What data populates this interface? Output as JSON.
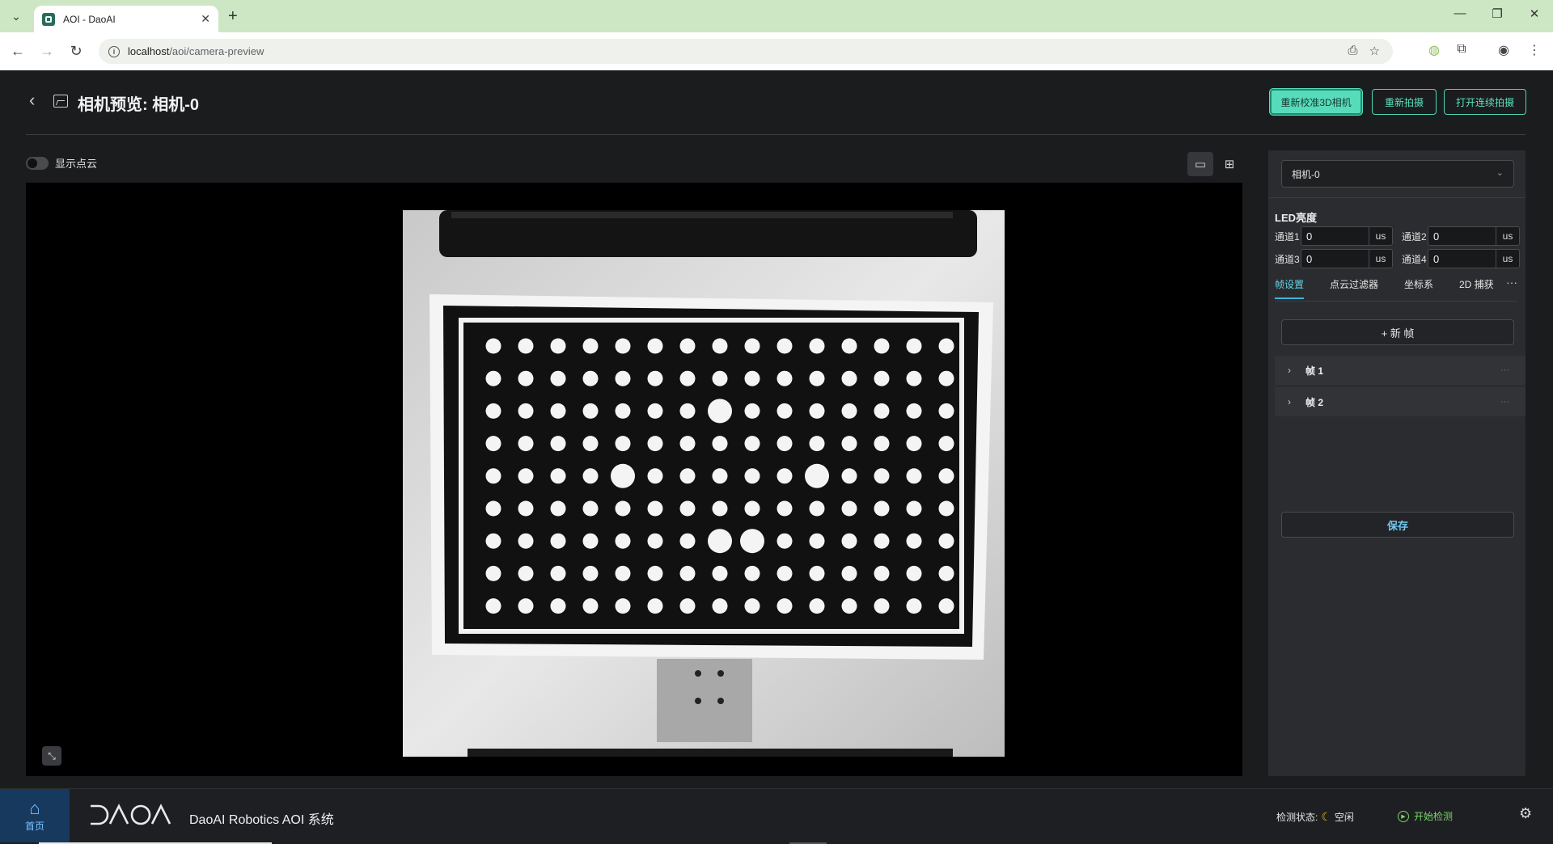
{
  "browser": {
    "tab_title": "AOI - DaoAI",
    "url_host": "localhost",
    "url_path": "/aoi/camera-preview"
  },
  "header": {
    "title": "相机预览: 相机-0",
    "recalibrate_label": "重新校准3D相机",
    "recapture_label": "重新拍摄",
    "continuous_label": "打开连续拍摄"
  },
  "viewer": {
    "point_cloud_toggle_label": "显示点云",
    "point_cloud_enabled": false,
    "dot_grid": {
      "rows": 9,
      "cols": 15
    }
  },
  "side": {
    "camera_select_value": "相机-0",
    "led_title": "LED亮度",
    "channels": [
      {
        "label": "通道1",
        "value": "0",
        "unit": "us"
      },
      {
        "label": "通道2",
        "value": "0",
        "unit": "us"
      },
      {
        "label": "通道3",
        "value": "0",
        "unit": "us"
      },
      {
        "label": "通道4",
        "value": "0",
        "unit": "us"
      }
    ],
    "tabs": [
      "帧设置",
      "点云过滤器",
      "坐标系",
      "2D 捕获"
    ],
    "active_tab": "帧设置",
    "add_frame_label": "+ 新 帧",
    "frames": [
      {
        "name": "帧 1",
        "more": "···"
      },
      {
        "name": "帧 2",
        "more": "···"
      }
    ],
    "save_label": "保存"
  },
  "bottom": {
    "home_label": "首页",
    "app_name": "DaoAI Robotics AOI 系统",
    "status_label": "检测状态:",
    "status_value": "空闲",
    "start_label": "开始检测"
  },
  "colors": {
    "accent": "#57dcbb",
    "tab_accent": "#3ab6d8",
    "start_green": "#78d66b",
    "chrome_tabbar": "#cde6c3"
  }
}
